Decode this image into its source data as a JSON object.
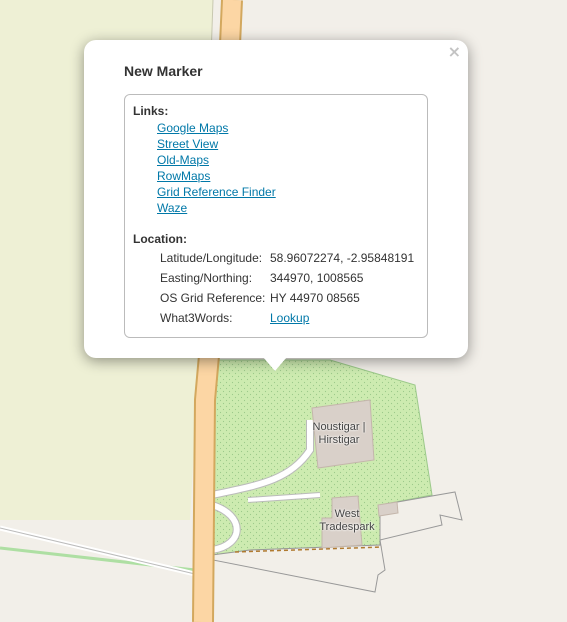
{
  "popup": {
    "title": "New Marker",
    "close_label": "×",
    "links_heading": "Links:",
    "links": [
      {
        "label": "Google Maps"
      },
      {
        "label": "Street View"
      },
      {
        "label": "Old-Maps"
      },
      {
        "label": "RowMaps"
      },
      {
        "label": "Grid Reference Finder"
      },
      {
        "label": "Waze"
      }
    ],
    "location_heading": "Location:",
    "location": {
      "latlng_label": "Latitude/Longitude:",
      "latlng_value": "58.96072274, -2.95848191",
      "easting_label": "Easting/Northing:",
      "easting_value": "344970, 1008565",
      "osgrid_label": "OS Grid Reference:",
      "osgrid_value": "HY 44970 08565",
      "w3w_label": "What3Words:",
      "w3w_link": "Lookup"
    }
  },
  "map": {
    "labels": {
      "building1": "Noustigar | Hirstigar",
      "building2": "West Tradespark"
    },
    "colors": {
      "background": "#f2efe9",
      "farmland": "#eef0d5",
      "grass": "#cdebb0",
      "road_fill": "#fcd6a4",
      "road_casing": "#d3a85e",
      "building": "#d9d0c9",
      "footway": "#aedfa3"
    }
  }
}
